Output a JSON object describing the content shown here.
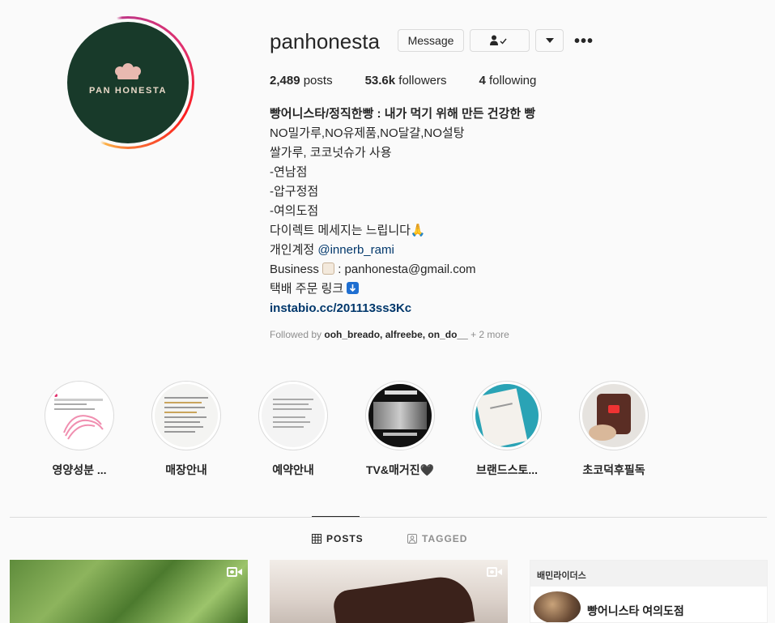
{
  "profile": {
    "username": "panhonesta",
    "avatar_logo_text": "PAN HONESTA",
    "message_label": "Message",
    "follow_icon": "person-check-icon",
    "dropdown_icon": "chevron-down-icon",
    "more_label": "•••"
  },
  "stats": {
    "posts_count": "2,489",
    "posts_label": "posts",
    "followers_count": "53.6k",
    "followers_label": "followers",
    "following_count": "4",
    "following_label": "following"
  },
  "bio": {
    "line1": "빵어니스타/정직한빵 : 내가 먹기 위해 만든 건강한 빵",
    "line2": "NO밀가루,NO유제품,NO달걀,NO설탕",
    "line3": "쌀가루, 코코넛슈가 사용",
    "line4": "-연남점",
    "line5": "-압구정점",
    "line6": "-여의도점",
    "line7": "다이렉트 메세지는 느립니다🙏",
    "line8_prefix": "개인계정 ",
    "line8_mention": "@innerb_rami",
    "line9_prefix": "Business ",
    "line9_suffix": " : panhonesta@gmail.com",
    "line10": "택배 주문 링크",
    "link": "instabio.cc/201113ss3Kc"
  },
  "followed_by": {
    "prefix": "Followed by ",
    "names": "ooh_breado, alfreebe, on_do__",
    "more": " + 2 more"
  },
  "highlights": [
    {
      "label": "영양성분 ..."
    },
    {
      "label": "매장안내"
    },
    {
      "label": "예약안내"
    },
    {
      "label": "TV&매거진🖤"
    },
    {
      "label": "브랜드스토..."
    },
    {
      "label": "초코덕후필독"
    }
  ],
  "tabs": {
    "posts": "POSTS",
    "tagged": "TAGGED"
  },
  "posts": {
    "third_header": "배민라이더스",
    "third_title": "빵어니스타 여의도점"
  },
  "colors": {
    "accent_link": "#00376b",
    "avatar_bg": "#183a2a",
    "logo_pink": "#e8b9b0"
  }
}
